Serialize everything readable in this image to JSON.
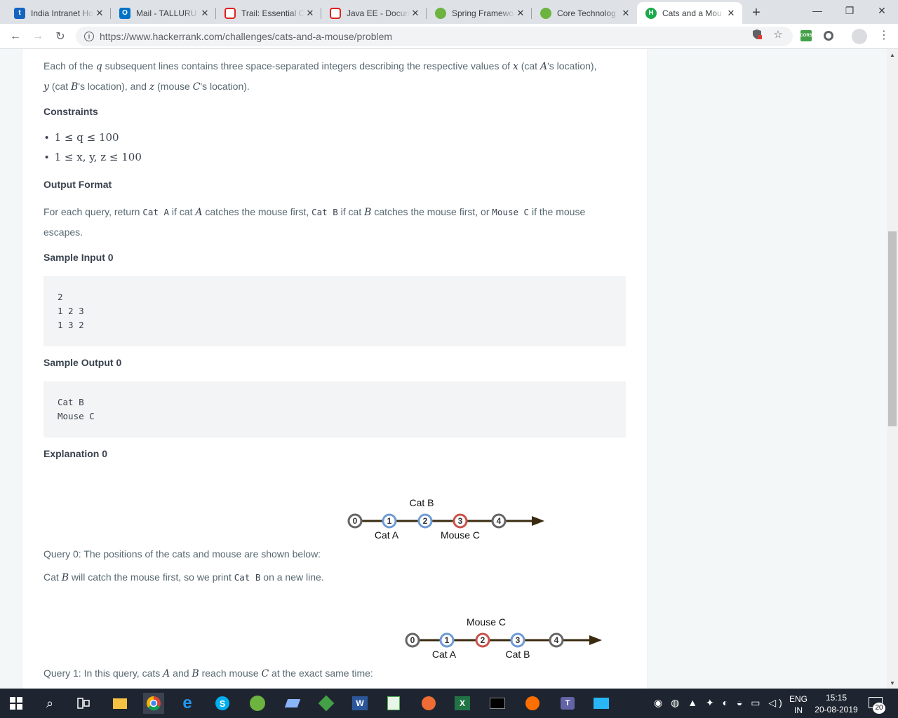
{
  "browser": {
    "tabs": [
      {
        "title": "India Intranet Ho",
        "favicon": "t",
        "color": "#1565c0"
      },
      {
        "title": "Mail - TALLURU",
        "favicon": "O",
        "color": "#0072c6"
      },
      {
        "title": "Trail: Essential Cl",
        "favicon": "O",
        "color": "#e0201b"
      },
      {
        "title": "Java EE - Docum",
        "favicon": "O",
        "color": "#e0201b"
      },
      {
        "title": "Spring Framewo",
        "favicon": "S",
        "color": "#6db33f"
      },
      {
        "title": "Core Technolog",
        "favicon": "S",
        "color": "#6db33f"
      },
      {
        "title": "Cats and a Mou",
        "favicon": "H",
        "color": "#1ba94c"
      }
    ],
    "url": "https://www.hackerrank.com/challenges/cats-and-a-mouse/problem",
    "ext_badge": "CORS"
  },
  "content": {
    "input_line_1": "Each of the",
    "input_q": "q",
    "input_line_2": "subsequent lines contains three space-separated integers describing the respective values of",
    "input_x": "x",
    "input_cat_a": "(cat",
    "input_A": "A",
    "input_loc": "'s location),",
    "input_y": "y",
    "input_cat_b": "(cat",
    "input_B": "B",
    "input_loc_b": "'s location), and",
    "input_z": "z",
    "input_mouse": "(mouse",
    "input_C": "C",
    "input_loc_c": "'s location).",
    "constraints_heading": "Constraints",
    "constraint_1": "1 ≤ q ≤ 100",
    "constraint_2": "1 ≤ x, y, z ≤ 100",
    "output_heading": "Output Format",
    "output_1": "For each query, return",
    "output_code_a": "Cat A",
    "output_2": "if cat",
    "output_A": "A",
    "output_3": "catches the mouse first,",
    "output_code_b": "Cat B",
    "output_4": "if cat",
    "output_B": "B",
    "output_5": "catches the mouse first, or",
    "output_code_c": "Mouse C",
    "output_6": "if the mouse",
    "output_7": "escapes.",
    "sample_input_heading": "Sample Input 0",
    "sample_input": "2\n1 2 3\n1 3 2",
    "sample_output_heading": "Sample Output 0",
    "sample_output": "Cat B\nMouse C",
    "explanation_heading": "Explanation 0",
    "diagram0": {
      "top_label": "Cat B",
      "bottom_left": "Cat A",
      "bottom_right": "Mouse C",
      "nodes": [
        "0",
        "1",
        "2",
        "3",
        "4"
      ]
    },
    "query0_text": "Query 0: The positions of the cats and mouse are shown below:",
    "query0_result_1": "Cat",
    "query0_B": "B",
    "query0_result_2": "will catch the mouse first, so we print",
    "query0_code": "Cat B",
    "query0_result_3": "on a new line.",
    "diagram1": {
      "top_label": "Mouse C",
      "bottom_left": "Cat A",
      "bottom_right": "Cat B",
      "nodes": [
        "0",
        "1",
        "2",
        "3",
        "4"
      ]
    },
    "query1_1": "Query 1: In this query, cats",
    "query1_A": "A",
    "query1_and": "and",
    "query1_B": "B",
    "query1_2": "reach mouse",
    "query1_C": "C",
    "query1_3": "at the exact same time:"
  },
  "taskbar": {
    "lang_1": "ENG",
    "lang_2": "IN",
    "time": "15:15",
    "date": "20-08-2019",
    "notifications": "20"
  }
}
